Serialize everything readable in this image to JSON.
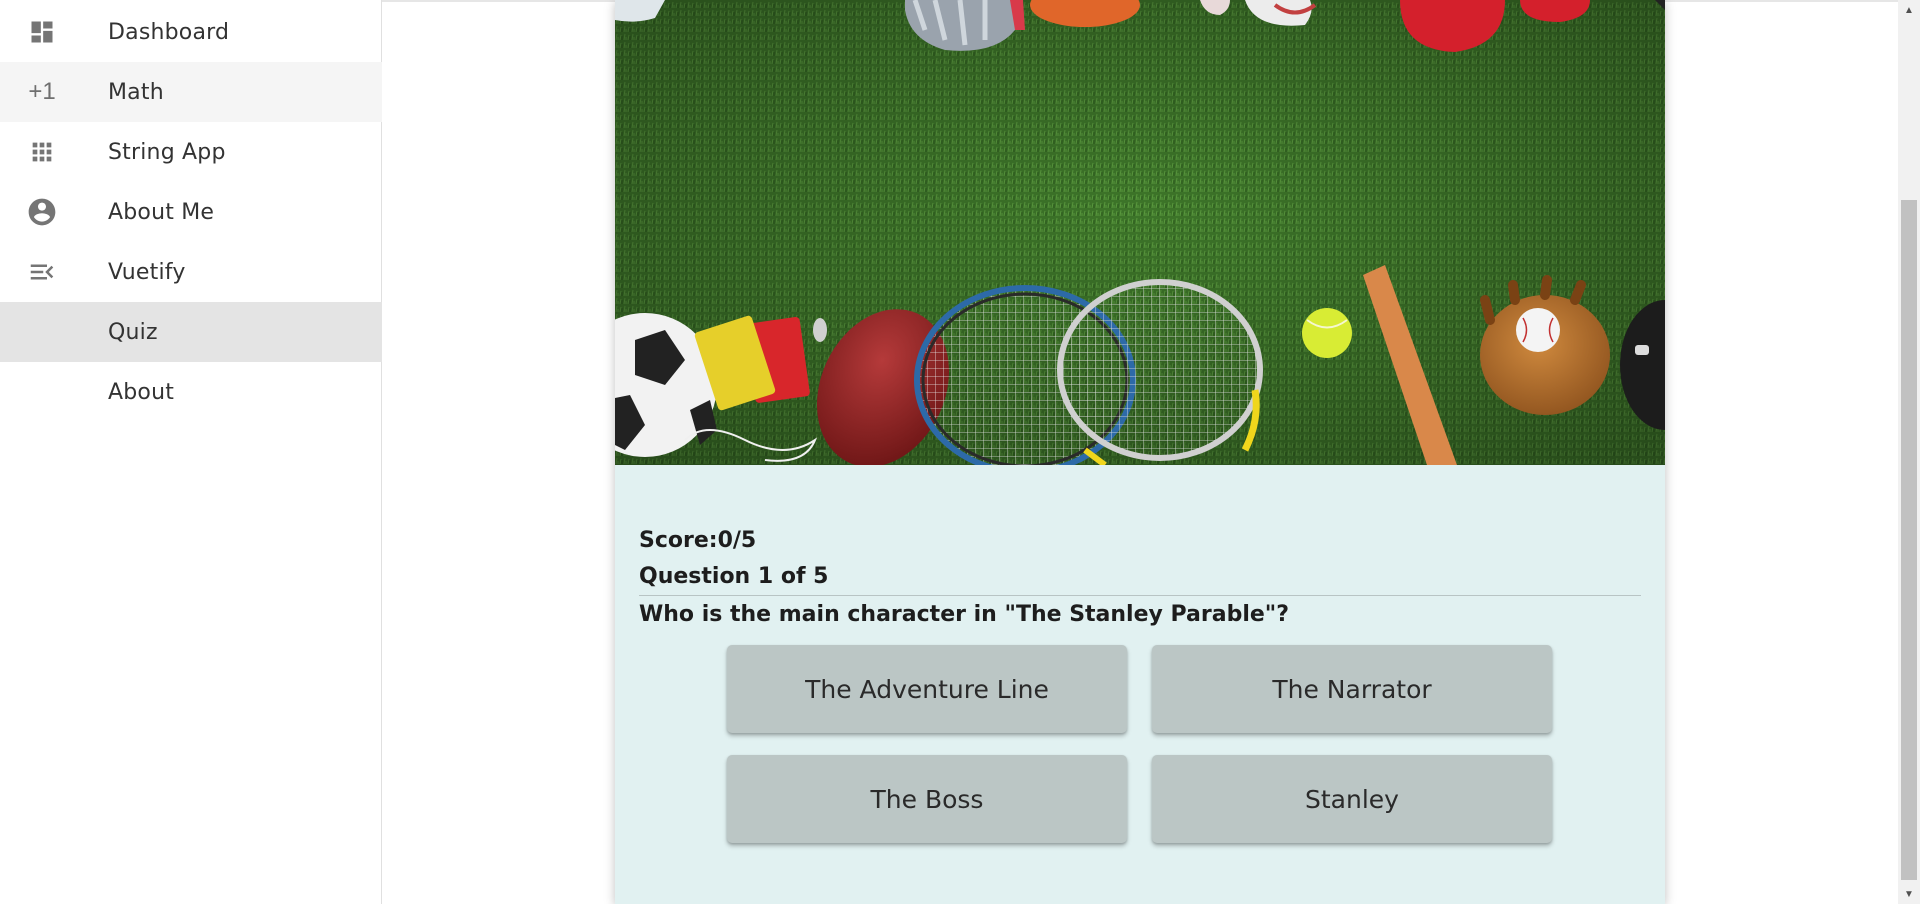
{
  "sidebar": {
    "items": [
      {
        "label": "Dashboard",
        "icon": "dashboard-icon"
      },
      {
        "label": "Math",
        "icon": "plus-one-icon"
      },
      {
        "label": "String App",
        "icon": "apps-grid-icon"
      },
      {
        "label": "About Me",
        "icon": "account-circle-icon"
      },
      {
        "label": "Vuetify",
        "icon": "menu-open-icon"
      },
      {
        "label": "Quiz",
        "icon": ""
      },
      {
        "label": "About",
        "icon": ""
      }
    ],
    "plus_one_glyph": "+1",
    "active_item": "Quiz",
    "hovered_item": "Math"
  },
  "quiz": {
    "score": "Score:0/5",
    "question_number": "Question 1 of 5",
    "question": "Who is the main character in \"The Stanley Parable\"?",
    "answers": [
      "The Adventure Line",
      "The Narrator",
      "The Boss",
      "Stanley"
    ]
  },
  "colors": {
    "card_background": "#e1f1f1",
    "answer_button": "#bbc6c5",
    "active_nav": "#e4e4e4",
    "grass": "#3f7a2a"
  }
}
